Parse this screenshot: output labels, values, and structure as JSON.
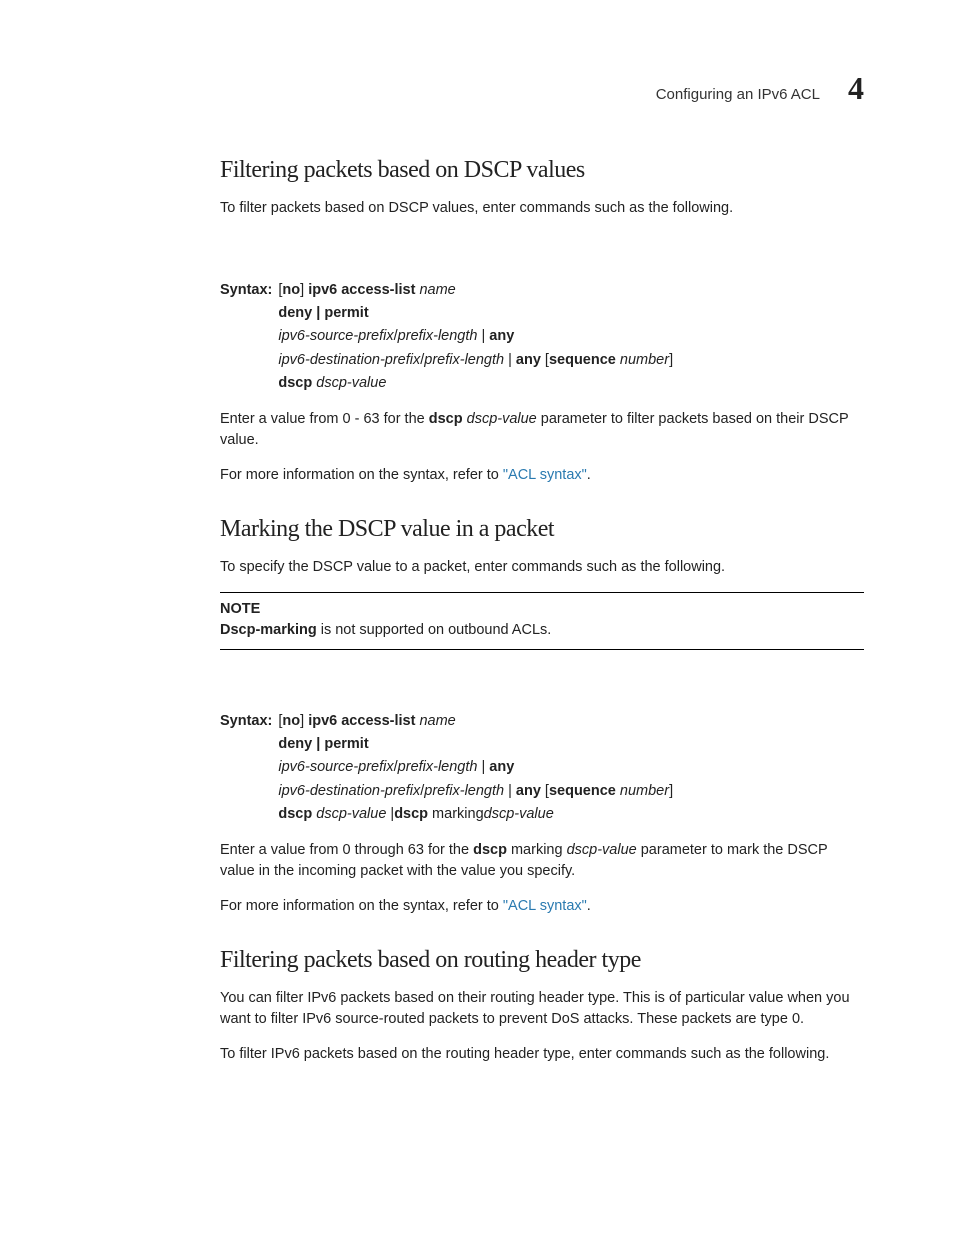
{
  "header": {
    "title": "Configuring an IPv6 ACL",
    "number": "4"
  },
  "sections": {
    "s1": {
      "heading": "Filtering packets based on DSCP values",
      "intro": "To filter packets based on DSCP values, enter commands such as the following.",
      "syntax_label": "Syntax:",
      "syntax": {
        "l1_pre": "[",
        "l1_no": "no",
        "l1_mid": "] ",
        "l1_cmd": "ipv6 access-list",
        "l1_name": " name",
        "l2": "deny | permit",
        "l3_a": "ipv6-source-prefix",
        "l3_slash": "/",
        "l3_b": "prefix-length",
        "l3_pipe": " | ",
        "l3_any": "any",
        "l4_a": "ipv6-destination-prefix",
        "l4_slash": "/",
        "l4_b": "prefix-length",
        "l4_pipe": " | ",
        "l4_any": "any",
        "l4_open": " [",
        "l4_seq": "sequence",
        "l4_num": " number",
        "l4_close": "]",
        "l5_d": "dscp",
        "l5_v": " dscp-value"
      },
      "para2_pre": "Enter a value from 0 - 63 for the ",
      "para2_b1": "dscp",
      "para2_mid": " ",
      "para2_i1": "dscp-value",
      "para2_post": " parameter to filter packets based on their DSCP value.",
      "para3_pre": "For more information on the syntax, refer to ",
      "para3_link": "\"ACL syntax\"",
      "para3_post": "."
    },
    "s2": {
      "heading": "Marking the DSCP value in a packet",
      "intro": "To specify the DSCP value to a packet, enter commands such as the following.",
      "note_label": "NOTE",
      "note_b": "Dscp-marking",
      "note_rest": " is not supported on outbound ACLs.",
      "syntax_label": "Syntax:",
      "syntax": {
        "l1_pre": "[",
        "l1_no": "no",
        "l1_mid": "] ",
        "l1_cmd": "ipv6 access-list",
        "l1_name": " name",
        "l2": "deny | permit",
        "l3_a": "ipv6-source-prefix",
        "l3_slash": "/",
        "l3_b": "prefix-length",
        "l3_pipe": " | ",
        "l3_any": "any",
        "l4_a": "ipv6-destination-prefix",
        "l4_slash": "/",
        "l4_b": "prefix-length",
        "l4_pipe": " | ",
        "l4_any": "any",
        "l4_open": " [",
        "l4_seq": "sequence",
        "l4_num": " number",
        "l4_close": "]",
        "l5_d": "dscp",
        "l5_v": " dscp-value",
        "l5_pipe": " |",
        "l5_d2": "dscp",
        "l5_m": " marking",
        "l5_v2": "dscp-value"
      },
      "para2_pre": "Enter a value from 0 through 63 for the ",
      "para2_b1": "dscp",
      "para2_mid1": " marking ",
      "para2_i1": "dscp-value",
      "para2_post": " parameter to mark the DSCP value in the incoming packet with the value you specify.",
      "para3_pre": "For more information on the syntax, refer to ",
      "para3_link": "\"ACL syntax\"",
      "para3_post": "."
    },
    "s3": {
      "heading": "Filtering packets based on routing header type",
      "para1": "You can filter IPv6 packets based on their routing header type. This is of particular value when you want to filter IPv6 source-routed packets to prevent DoS attacks. These packets are type 0.",
      "para2": "To filter IPv6 packets based on the routing header type, enter commands such as the following."
    }
  }
}
